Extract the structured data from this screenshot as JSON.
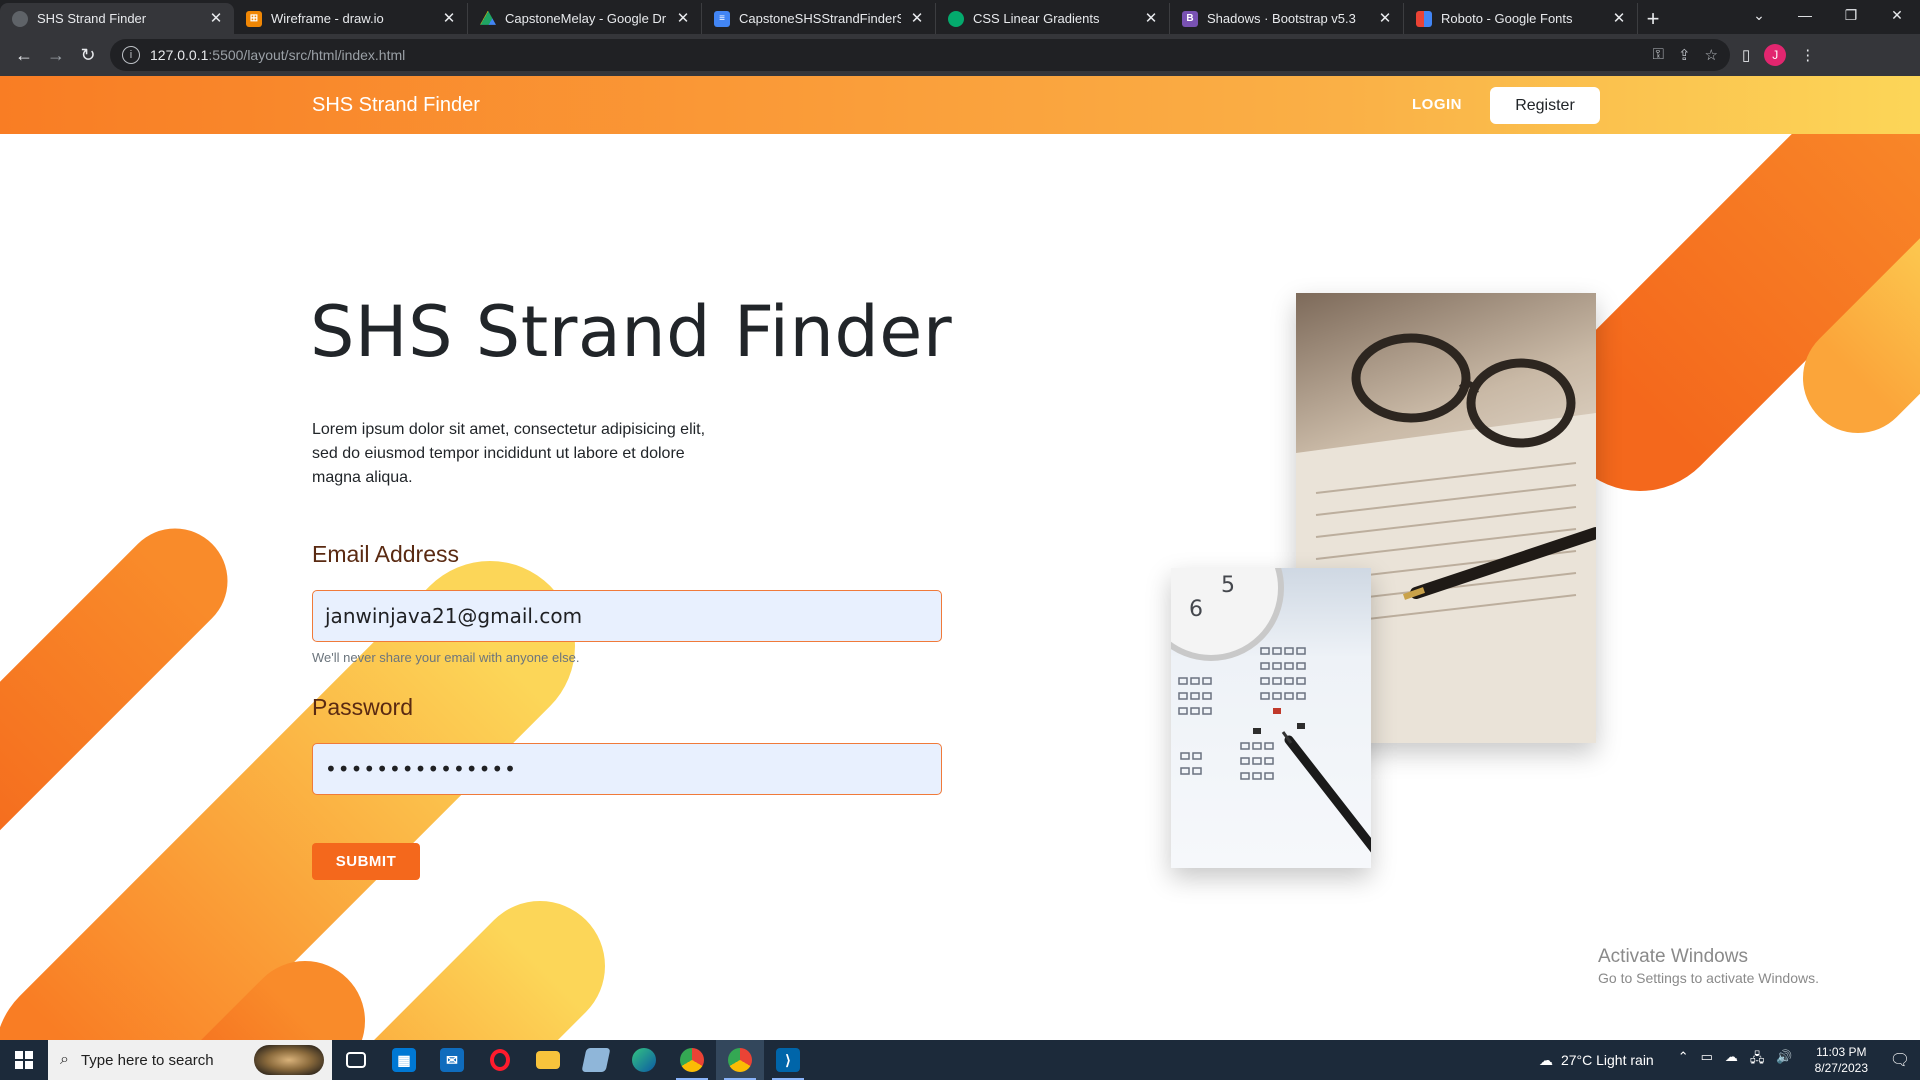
{
  "browser": {
    "tabs": [
      {
        "title": "SHS Strand Finder",
        "icon": "globe-icon",
        "color": "#5f6368",
        "active": true
      },
      {
        "title": "Wireframe - draw.io",
        "icon": "drawio-icon",
        "color": "#f08705"
      },
      {
        "title": "CapstoneMelay - Google Drive",
        "icon": "google-drive-icon",
        "color": "#1fa463"
      },
      {
        "title": "CapstoneSHSStrandFinderScript",
        "icon": "google-docs-icon",
        "color": "#4285f4"
      },
      {
        "title": "CSS Linear Gradients",
        "icon": "w3schools-icon",
        "color": "#04aa6d"
      },
      {
        "title": "Shadows · Bootstrap v5.3",
        "icon": "bootstrap-icon",
        "color": "#7952b3"
      },
      {
        "title": "Roboto - Google Fonts",
        "icon": "google-fonts-icon",
        "color": "#ea4335"
      }
    ],
    "url_host": "127.0.0.1",
    "url_path": ":5500/layout/src/html/index.html",
    "profile_initial": "J"
  },
  "navbar": {
    "brand": "SHS Strand Finder",
    "login": "LOGIN",
    "register": "Register"
  },
  "hero": {
    "title": "SHS Strand Finder",
    "description": "Lorem ipsum dolor sit amet, consectetur adipisicing elit, sed do eiusmod tempor incididunt ut labore et dolore magna aliqua."
  },
  "form": {
    "email_label": "Email Address",
    "email_value": "janwinjava21@gmail.com",
    "email_help": "We'll never share your email with anyone else.",
    "password_label": "Password",
    "password_value": "•••••••••••••••",
    "submit": "SUBMIT"
  },
  "watermark": {
    "line1": "Activate Windows",
    "line2": "Go to Settings to activate Windows."
  },
  "taskbar": {
    "search_placeholder": "Type here to search",
    "weather": "27°C  Light rain",
    "time": "11:03 PM",
    "date": "8/27/2023"
  },
  "colors": {
    "orange": "#f4681c",
    "orange_light": "#f97d24",
    "yellow": "#fcd658"
  }
}
